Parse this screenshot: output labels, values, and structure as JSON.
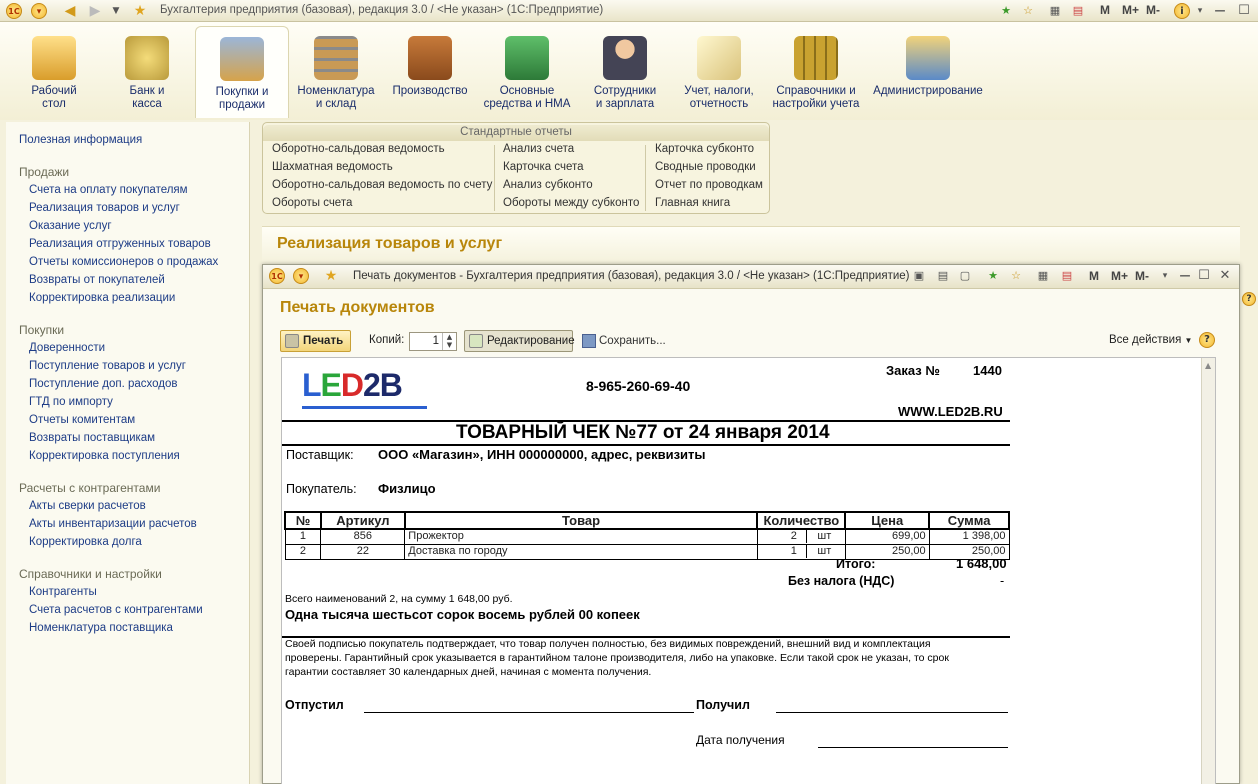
{
  "titlebar": {
    "title": "Бухгалтерия предприятия (базовая), редакция 3.0 / <Не указан>  (1С:Предприятие)",
    "logo": "1C",
    "m_buttons": [
      "M",
      "M+",
      "M-"
    ]
  },
  "sections": [
    {
      "label": "Рабочий\nстол",
      "icon": "desk-icon"
    },
    {
      "label": "Банк и\nкасса",
      "icon": "coins-icon"
    },
    {
      "label": "Покупки и\nпродажи",
      "icon": "truck-icon"
    },
    {
      "label": "Номенклатура\nи склад",
      "icon": "warehouse-icon"
    },
    {
      "label": "Производство",
      "icon": "toolbox-icon"
    },
    {
      "label": "Основные\nсредства и НМА",
      "icon": "factory-icon"
    },
    {
      "label": "Сотрудники\nи зарплата",
      "icon": "employee-icon"
    },
    {
      "label": "Учет, налоги,\nотчетность",
      "icon": "documents-icon"
    },
    {
      "label": "Справочники и\nнастройки учета",
      "icon": "binders-icon"
    },
    {
      "label": "Администрирование",
      "icon": "computer-icon"
    }
  ],
  "left_panel": {
    "useful_info": "Полезная информация",
    "groups": [
      {
        "title": "Продажи",
        "items": [
          "Счета на оплату покупателям",
          "Реализация товаров и услуг",
          "Оказание услуг",
          "Реализация отгруженных товаров",
          "Отчеты комиссионеров о продажах",
          "Возвраты от покупателей",
          "Корректировка реализации"
        ]
      },
      {
        "title": "Покупки",
        "items": [
          "Доверенности",
          "Поступление товаров и услуг",
          "Поступление доп. расходов",
          "ГТД по импорту",
          "Отчеты комитентам",
          "Возвраты поставщикам",
          "Корректировка поступления"
        ]
      },
      {
        "title": "Расчеты с контрагентами",
        "items": [
          "Акты сверки расчетов",
          "Акты инвентаризации расчетов",
          "Корректировка долга"
        ]
      },
      {
        "title": "Справочники и настройки",
        "items": [
          "Контрагенты",
          "Счета расчетов с контрагентами",
          "Номенклатура поставщика"
        ]
      }
    ]
  },
  "std_reports": {
    "title": "Стандартные отчеты",
    "col1": [
      "Оборотно-сальдовая ведомость",
      "Шахматная ведомость",
      "Оборотно-сальдовая ведомость по счету",
      "Обороты счета"
    ],
    "col2": [
      "Анализ счета",
      "Карточка счета",
      "Анализ субконто",
      "Обороты между субконто"
    ],
    "col3": [
      "Карточка субконто",
      "Сводные проводки",
      "Отчет по проводкам",
      "Главная книга"
    ]
  },
  "main_heading": "Реализация товаров и услуг",
  "print_window": {
    "title": "Печать документов - Бухгалтерия предприятия (базовая), редакция 3.0 / <Не указан>  (1С:Предприятие)",
    "heading": "Печать документов",
    "print_label": "Печать",
    "copies_label": "Копий:",
    "copies_value": "1",
    "edit_label": "Редактирование",
    "save_label": "Сохранить...",
    "all_actions": "Все действия",
    "help": "?"
  },
  "document": {
    "logo_text": "LED2B",
    "phone": "8-965-260-69-40",
    "order_label": "Заказ №",
    "order_number": "1440",
    "website": "WWW.LED2B.RU",
    "title": "ТОВАРНЫЙ ЧЕК №77 от 24 января 2014",
    "supplier_label": "Поставщик:",
    "supplier_value": "ООО «Магазин», ИНН 000000000, адрес, реквизиты",
    "buyer_label": "Покупатель:",
    "buyer_value": "Физлицо",
    "table_headers": [
      "№",
      "Артикул",
      "Товар",
      "Количество",
      "Цена",
      "Сумма"
    ],
    "rows": [
      {
        "n": "1",
        "art": "856",
        "name": "Прожектор",
        "qty": "2",
        "unit": "шт",
        "price": "699,00",
        "sum": "1 398,00"
      },
      {
        "n": "2",
        "art": "22",
        "name": "Доставка по городу",
        "qty": "1",
        "unit": "шт",
        "price": "250,00",
        "sum": "250,00"
      }
    ],
    "total_label": "Итого:",
    "total_value": "1 648,00",
    "vat_label": "Без налога (НДС)",
    "vat_value": "-",
    "summary_line": "Всего наименований 2, на сумму 1 648,00 руб.",
    "amount_words": "Одна тысяча шестьсот сорок восемь рублей 00 копеек",
    "disclaimer_1": "Своей подписью покупатель подтверждает, что товар получен полностью, без видимых повреждений, внешний вид и комплектация",
    "disclaimer_2": "проверены.  Гарантийный срок указывается в гарантийном талоне производителя, либо на упаковке. Если такой срок не указан, то срок",
    "disclaimer_3": "гарантии составляет 30 календарных дней, начиная с момента получения.",
    "released_label": "Отпустил",
    "received_label": "Получил",
    "date_received_label": "Дата получения"
  }
}
